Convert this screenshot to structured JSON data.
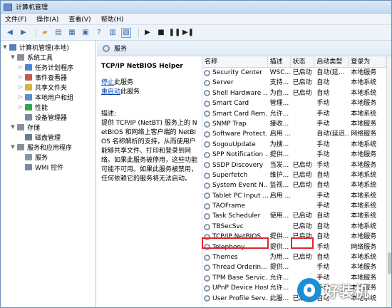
{
  "window": {
    "title": "计算机管理"
  },
  "menu": [
    "文件(F)",
    "操作(A)",
    "查看(V)",
    "帮助(H)"
  ],
  "toolbar": {
    "icons": [
      "back-arrow-icon",
      "forward-arrow-icon",
      "folder-up-icon",
      "console-tree-icon",
      "export-icon",
      "properties-icon",
      "help-icon",
      "extended-view-icon",
      "standard-view-icon",
      "play-icon",
      "stop-icon",
      "pause-icon",
      "restart-icon"
    ]
  },
  "tree": [
    {
      "label": "计算机管理(本地)",
      "level": 0,
      "arrow": "▼",
      "icon": "computer-icon",
      "color": "#5a7fb4"
    },
    {
      "label": "系统工具",
      "level": 1,
      "arrow": "▼",
      "icon": "tools-icon",
      "color": "#8a8f99"
    },
    {
      "label": "任务计划程序",
      "level": 2,
      "arrow": "▷",
      "icon": "clock-icon",
      "color": "#4b86c7"
    },
    {
      "label": "事件查看器",
      "level": 2,
      "arrow": "▷",
      "icon": "event-viewer-icon",
      "color": "#c7594b"
    },
    {
      "label": "共享文件夹",
      "level": 2,
      "arrow": "▷",
      "icon": "shared-folder-icon",
      "color": "#d9b444"
    },
    {
      "label": "本地用户和组",
      "level": 2,
      "arrow": "▷",
      "icon": "users-icon",
      "color": "#5b8fd0"
    },
    {
      "label": "性能",
      "level": 2,
      "arrow": "▷",
      "icon": "performance-icon",
      "color": "#3aa34a"
    },
    {
      "label": "设备管理器",
      "level": 2,
      "arrow": "",
      "icon": "device-manager-icon",
      "color": "#7c8aa0"
    },
    {
      "label": "存储",
      "level": 1,
      "arrow": "▼",
      "icon": "storage-icon",
      "color": "#8a8f99"
    },
    {
      "label": "磁盘管理",
      "level": 2,
      "arrow": "",
      "icon": "disk-icon",
      "color": "#6c7b8f"
    },
    {
      "label": "服务和应用程序",
      "level": 1,
      "arrow": "▼",
      "icon": "services-apps-icon",
      "color": "#8a8f99"
    },
    {
      "label": "服务",
      "level": 2,
      "arrow": "",
      "icon": "services-gear-icon",
      "color": "#8796aa"
    },
    {
      "label": "WMI 控件",
      "level": 2,
      "arrow": "",
      "icon": "wmi-icon",
      "color": "#7c8aa0"
    }
  ],
  "services_header": "服务",
  "detail": {
    "title": "TCP/IP NetBIOS Helper",
    "link_stop": "停止",
    "link_stop_suffix": "此服务",
    "link_restart": "重启动",
    "link_restart_suffix": "此服务",
    "desc_label": "描述:",
    "desc_text": "提供 TCP/IP (NetBT) 服务上的 NetBIOS 和网络上客户端的 NetBIOS 名称解析的支持，从而使用户能够共享文件、打印和登录到网络。如果此服务被停用，这些功能可能不可用。如果此服务被禁用，任何依赖它的服务将无法启动。"
  },
  "columns": [
    "名称",
    "描述",
    "状态",
    "启动类型",
    "登录为"
  ],
  "services": [
    [
      "Security Center",
      "WSC...",
      "已启动",
      "自动(延...",
      "本地服务"
    ],
    [
      "Server",
      "支持...",
      "已启动",
      "自动",
      "本地系统"
    ],
    [
      "Shell Hardware ...",
      "为自...",
      "已启动",
      "自动",
      "本地系统"
    ],
    [
      "Smart Card",
      "管理...",
      "",
      "手动",
      "本地服务"
    ],
    [
      "Smart Card Rem...",
      "允许...",
      "",
      "手动",
      "本地系统"
    ],
    [
      "SNMP Trap",
      "接收...",
      "",
      "手动",
      "本地服务"
    ],
    [
      "Software Protect...",
      "启用 ...",
      "",
      "自动(延迟...",
      "网络服务"
    ],
    [
      "SogouUpdate",
      "为搜...",
      "",
      "手动",
      "本地系统"
    ],
    [
      "SPP Notification ...",
      "提供...",
      "",
      "手动",
      "本地服务"
    ],
    [
      "SSDP Discovery",
      "当发...",
      "已启动",
      "手动",
      "本地服务"
    ],
    [
      "Superfetch",
      "维护...",
      "已启动",
      "自动",
      "本地系统"
    ],
    [
      "System Event N...",
      "监视...",
      "已启动",
      "自动",
      "本地系统"
    ],
    [
      "Tablet PC Input ...",
      "启用 ...",
      "",
      "手动",
      "本地系统"
    ],
    [
      "TAOFrame",
      "",
      "",
      "手动",
      "本地系统"
    ],
    [
      "Task Scheduler",
      "使用...",
      "已启动",
      "自动",
      "本地系统"
    ],
    [
      "TBSecSvc",
      "",
      "已启动",
      "自动",
      "本地系统"
    ],
    [
      "TCP/IP NetBIOS ...",
      "提供...",
      "已启动",
      "自动",
      "本地服务"
    ],
    [
      "Telephony",
      "提供...",
      "",
      "手动",
      "网络服务"
    ],
    [
      "Themes",
      "为用...",
      "已启动",
      "自动",
      "本地系统"
    ],
    [
      "Thread Orderin...",
      "提供...",
      "",
      "手动",
      "本地服务"
    ],
    [
      "TPM Base Servic...",
      "允许...",
      "",
      "手动",
      "本地服务"
    ],
    [
      "UPnP Device Host",
      "允许...",
      "",
      "手动",
      "本地服务"
    ],
    [
      "User Profile Serv...",
      "此服...",
      "已启动",
      "自动",
      "本地系统"
    ]
  ],
  "highlight_color": "#e0262d",
  "watermark": {
    "text": "好装机",
    "icon": "eye-logo-icon"
  }
}
